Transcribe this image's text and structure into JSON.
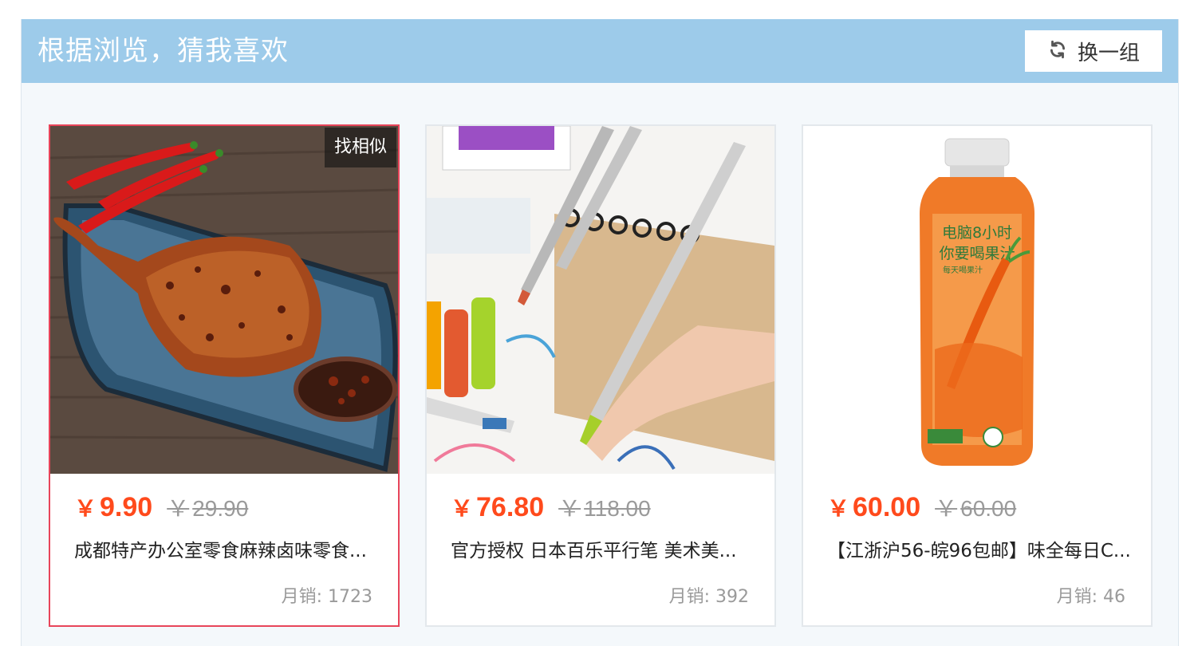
{
  "header": {
    "title": "根据浏览，猜我喜欢",
    "refresh_label": "换一组",
    "refresh_icon": "refresh-icon",
    "background_color": "#9dcbea"
  },
  "colors": {
    "price": "#ff4a1c",
    "active_border": "#e8455a"
  },
  "products": [
    {
      "similar_label": "找相似",
      "currency": "￥",
      "price": "9.90",
      "original_price": "29.90",
      "title": "成都特产办公室零食麻辣卤味零食...",
      "sales": "月销: 1723",
      "image": "spicy-duck-leg-image"
    },
    {
      "currency": "￥",
      "price": "76.80",
      "original_price": "118.00",
      "title": "官方授权 日本百乐平行笔 美术美...",
      "sales": "月销: 392",
      "image": "calligraphy-pen-image"
    },
    {
      "currency": "￥",
      "price": "60.00",
      "original_price": "60.00",
      "title": "【江浙沪56-皖96包邮】味全每日C...",
      "sales": "月销: 46",
      "image": "carrot-juice-bottle-image",
      "bottle_text": [
        "电脑8小时",
        "你要喝果汁",
        "每天喝果汁"
      ]
    }
  ]
}
